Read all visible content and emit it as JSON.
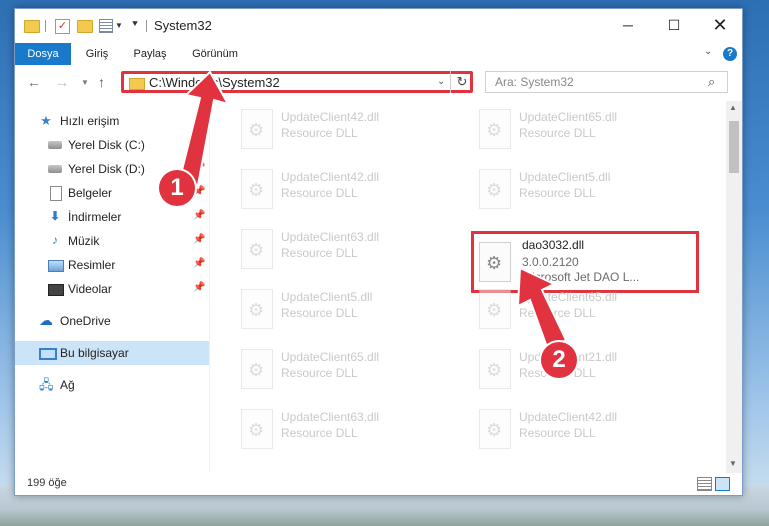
{
  "window": {
    "title": "System32",
    "controls": {
      "minimize": "─",
      "maximize": "☐",
      "close": "✕"
    }
  },
  "ribbon": {
    "tabs": [
      {
        "label": "Dosya"
      },
      {
        "label": "Giriş"
      },
      {
        "label": "Paylaş"
      },
      {
        "label": "Görünüm"
      }
    ],
    "help": "?"
  },
  "address": {
    "path": "C:\\Windows\\System32",
    "refresh": "↻"
  },
  "search": {
    "placeholder": "Ara: System32"
  },
  "sidebar": {
    "items": [
      {
        "label": "Hızlı erişim"
      },
      {
        "label": "Yerel Disk (C:)"
      },
      {
        "label": "Yerel Disk (D:)"
      },
      {
        "label": "Belgeler"
      },
      {
        "label": "İndirmeler"
      },
      {
        "label": "Müzik"
      },
      {
        "label": "Resimler"
      },
      {
        "label": "Videolar"
      },
      {
        "label": "OneDrive"
      },
      {
        "label": "Bu bilgisayar"
      },
      {
        "label": "Ağ"
      }
    ]
  },
  "files": [
    {
      "name": "UpdateClient42.dll",
      "type": "Resource DLL"
    },
    {
      "name": "UpdateClient65.dll",
      "type": "Resource DLL"
    },
    {
      "name": "UpdateClient42.dll",
      "type": "Resource DLL"
    },
    {
      "name": "UpdateClient5.dll",
      "type": "Resource DLL"
    },
    {
      "name": "UpdateClient63.dll",
      "type": "Resource DLL"
    },
    {
      "name": "dao3032.dll",
      "version": "3.0.0.2120",
      "description": "Microsoft Jet DAO L..."
    },
    {
      "name": "UpdateClient5.dll",
      "type": "Resource DLL"
    },
    {
      "name": "UpdateClient65.dll",
      "type": "Resource DLL"
    },
    {
      "name": "UpdateClient65.dll",
      "type": "Resource DLL"
    },
    {
      "name": "UpdateClient21.dll",
      "type": "Resource DLL"
    },
    {
      "name": "UpdateClient63.dll",
      "type": "Resource DLL"
    },
    {
      "name": "UpdateClient42.dll",
      "type": "Resource DLL"
    }
  ],
  "status": {
    "count": "199 öğe"
  },
  "callouts": {
    "one": "1",
    "two": "2"
  },
  "colors": {
    "accent": "#1979ca",
    "highlight": "#e0333f"
  }
}
